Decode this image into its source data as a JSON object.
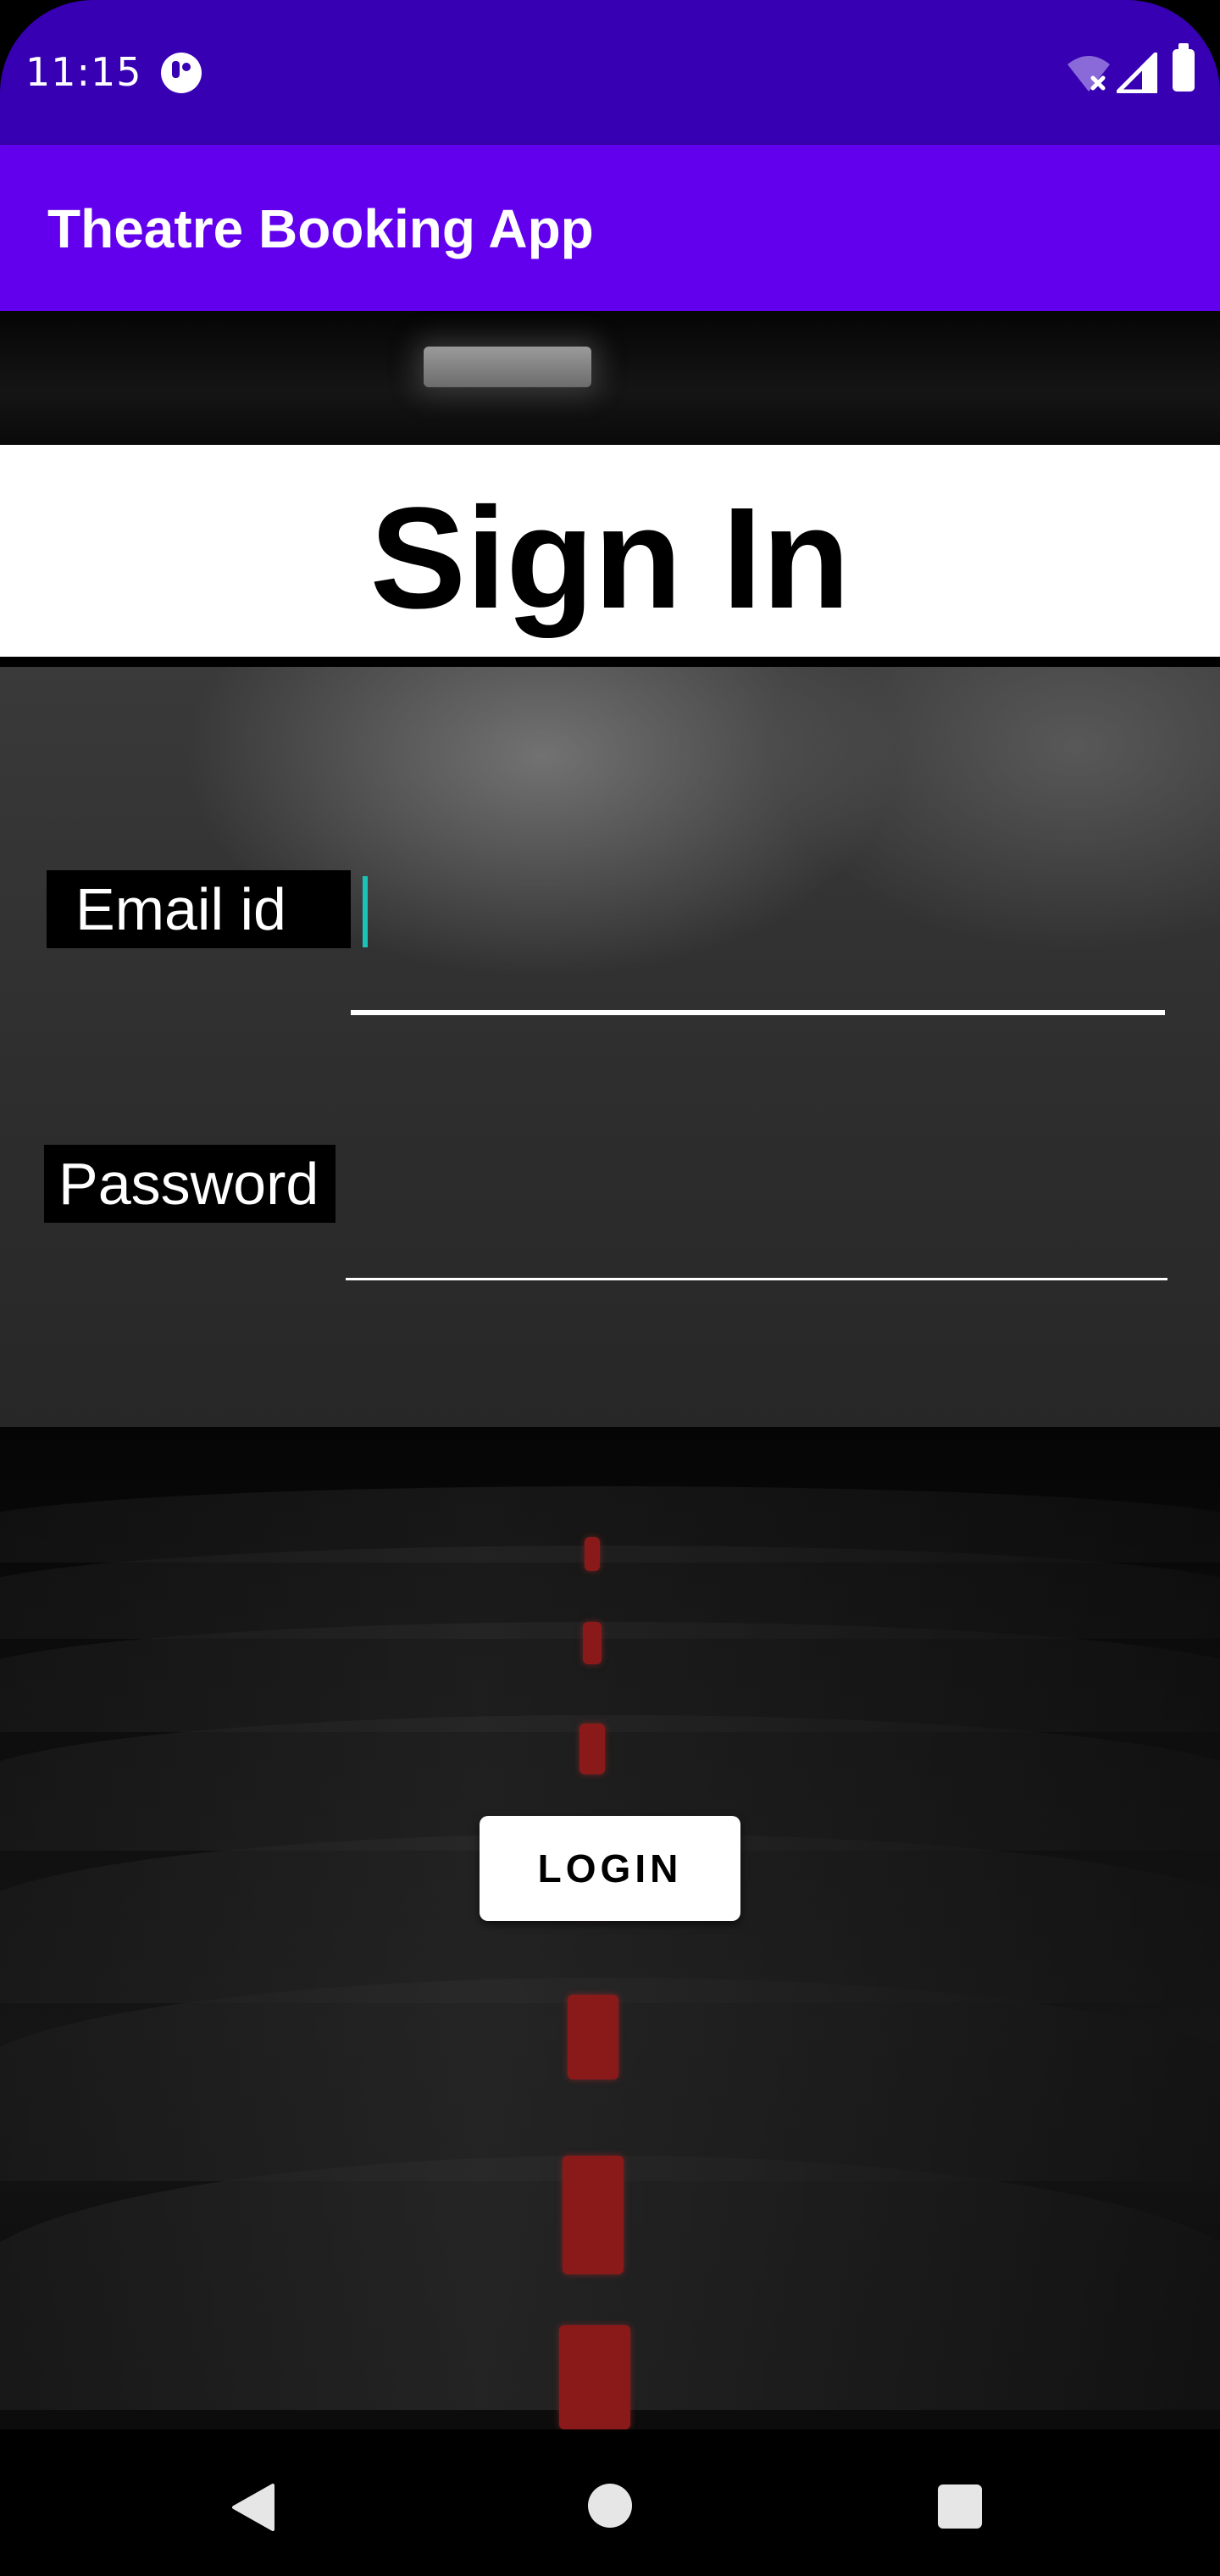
{
  "status_bar": {
    "time": "11:15",
    "icons": [
      "app-notification-icon",
      "wifi-off-icon",
      "signal-icon",
      "battery-icon"
    ]
  },
  "app_bar": {
    "title": "Theatre Booking App",
    "color": "#6200ee"
  },
  "page": {
    "heading": "Sign In"
  },
  "form": {
    "email_label": "Email id",
    "email_value": "",
    "password_label": "Password",
    "password_value": "",
    "cursor_color": "#19c3b5"
  },
  "actions": {
    "login_label": "LOGIN"
  },
  "nav_bar": {
    "icons": [
      "back-icon",
      "home-icon",
      "recents-icon"
    ]
  },
  "colors": {
    "status_bar": "#3700b3",
    "app_bar": "#6200ee"
  }
}
